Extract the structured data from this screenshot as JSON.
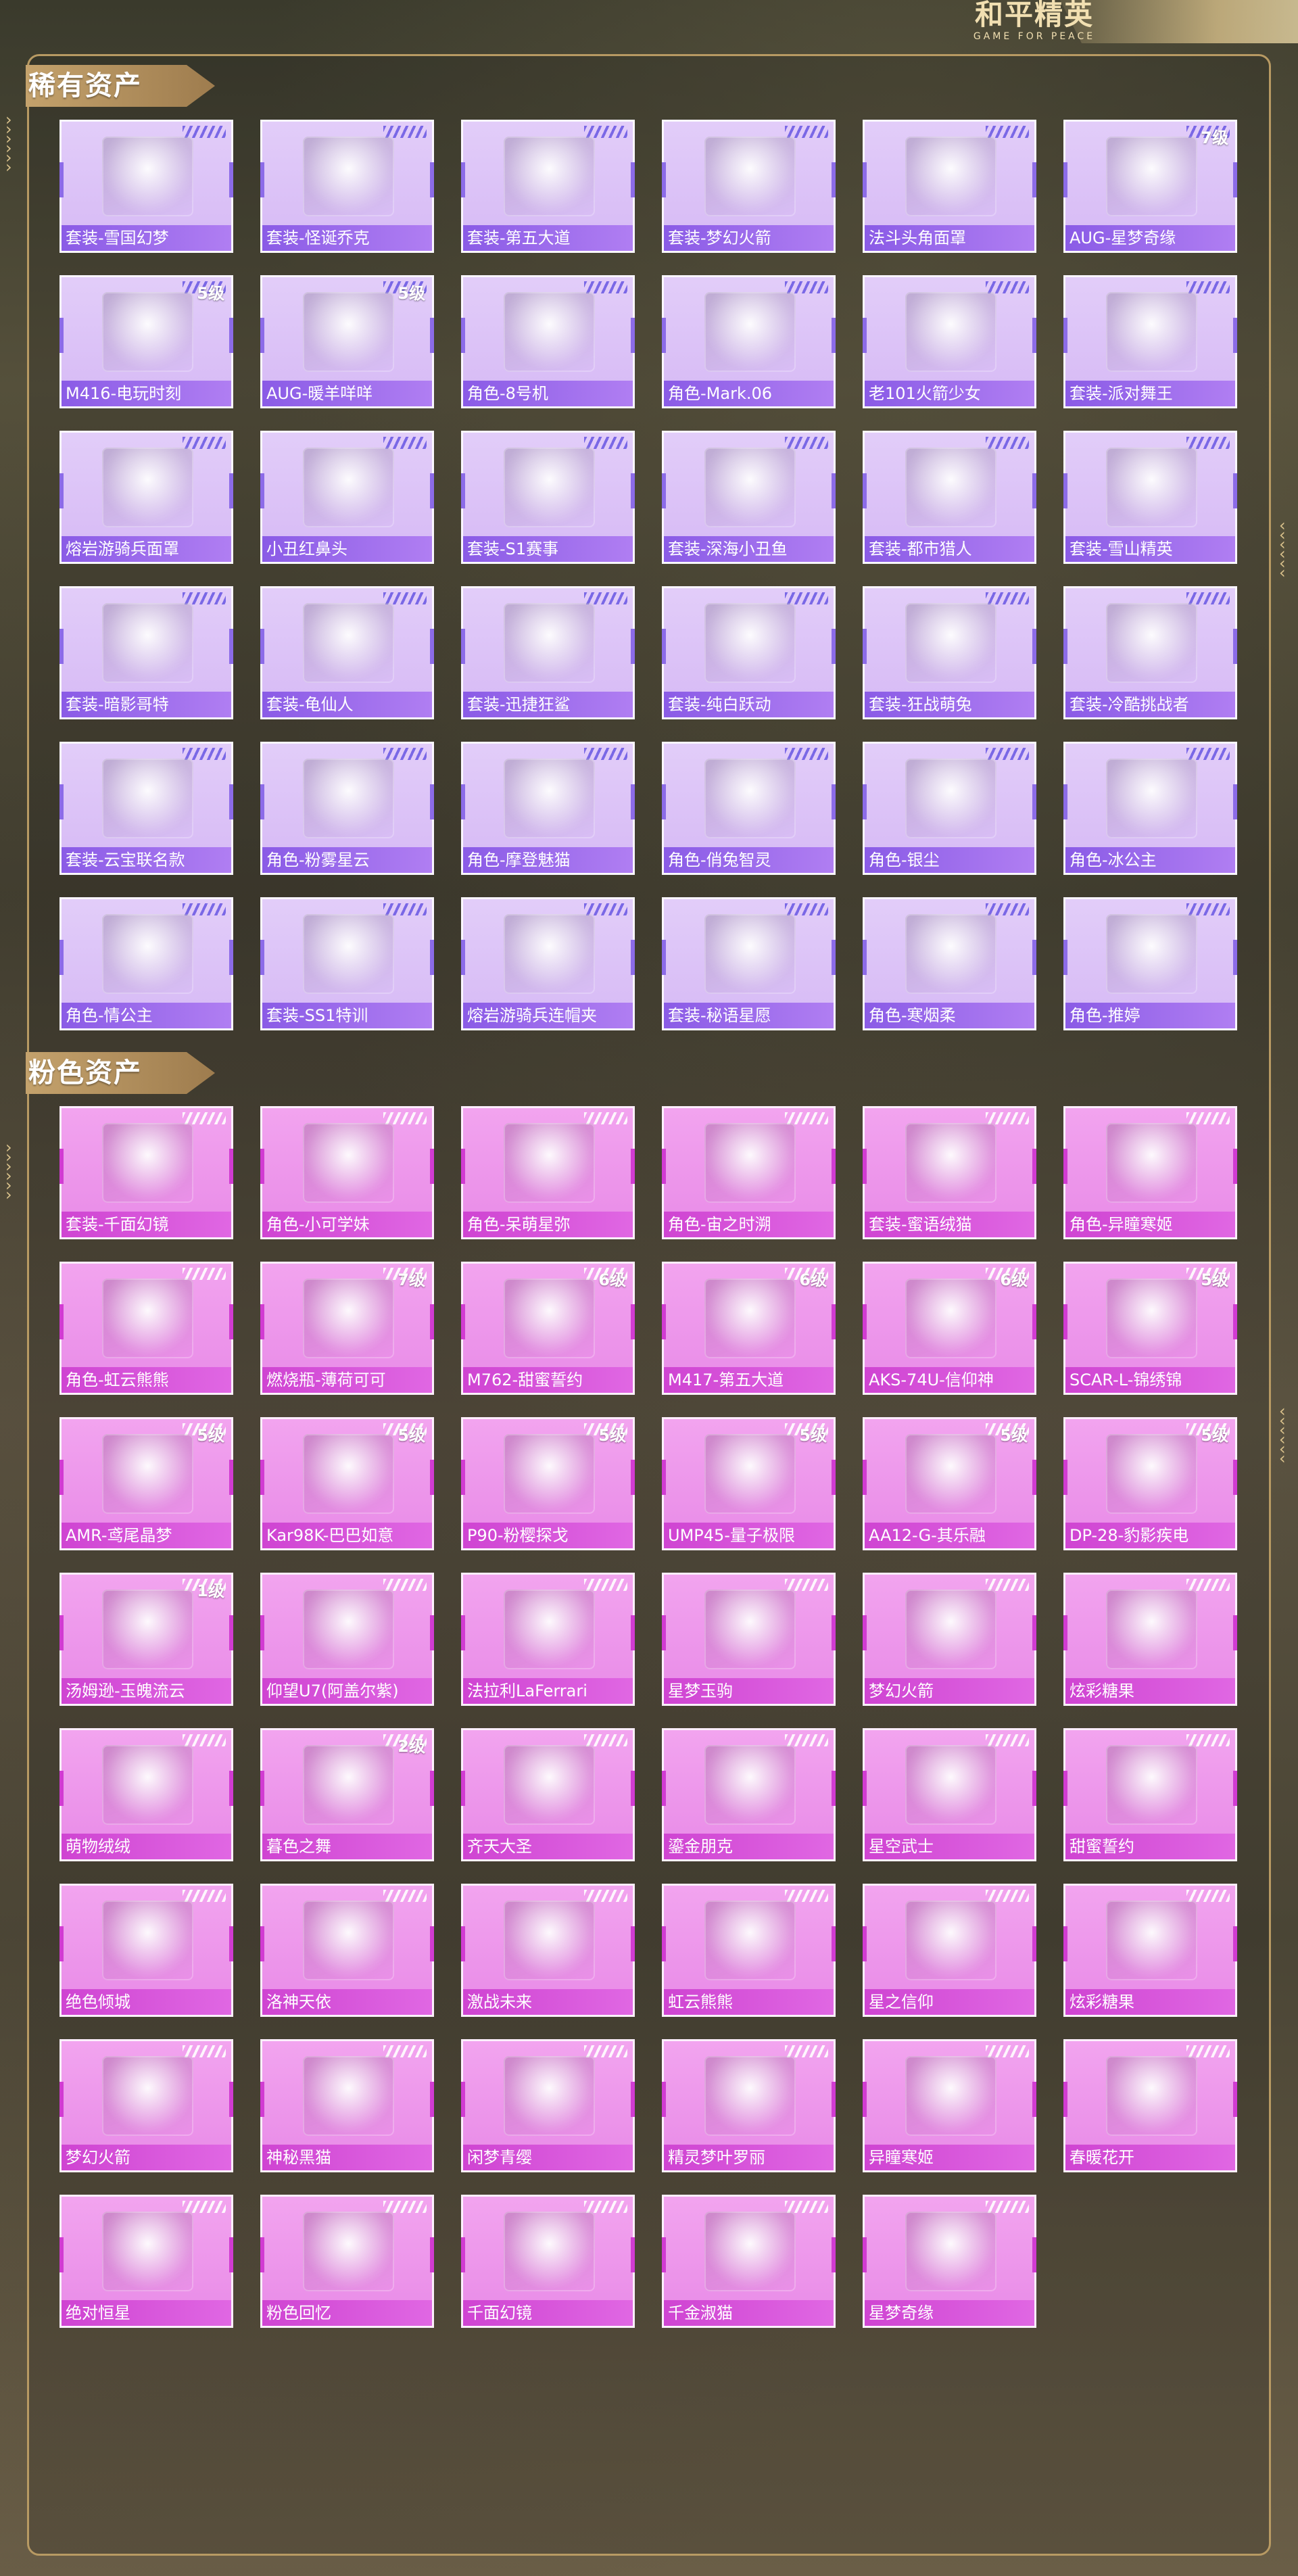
{
  "logo": {
    "title": "和平精英",
    "subtitle": "GAME FOR PEACE"
  },
  "sections": [
    {
      "id": "rare",
      "title": "稀有资产",
      "items": [
        {
          "label": "套装-雪国幻梦",
          "level": ""
        },
        {
          "label": "套装-怪诞乔克",
          "level": ""
        },
        {
          "label": "套装-第五大道",
          "level": ""
        },
        {
          "label": "套装-梦幻火箭",
          "level": ""
        },
        {
          "label": "法斗头角面罩",
          "level": ""
        },
        {
          "label": "AUG-星梦奇缘",
          "level": "7级"
        },
        {
          "label": "M416-电玩时刻",
          "level": "5级"
        },
        {
          "label": "AUG-暖羊咩咩",
          "level": "5级"
        },
        {
          "label": "角色-8号机",
          "level": ""
        },
        {
          "label": "角色-Mark.06",
          "level": ""
        },
        {
          "label": "老101火箭少女",
          "level": ""
        },
        {
          "label": "套装-派对舞王",
          "level": ""
        },
        {
          "label": "熔岩游骑兵面罩",
          "level": ""
        },
        {
          "label": "小丑红鼻头",
          "level": ""
        },
        {
          "label": "套装-S1赛事",
          "level": ""
        },
        {
          "label": "套装-深海小丑鱼",
          "level": ""
        },
        {
          "label": "套装-都市猎人",
          "level": ""
        },
        {
          "label": "套装-雪山精英",
          "level": ""
        },
        {
          "label": "套装-暗影哥特",
          "level": ""
        },
        {
          "label": "套装-龟仙人",
          "level": ""
        },
        {
          "label": "套装-迅捷狂鲨",
          "level": ""
        },
        {
          "label": "套装-纯白跃动",
          "level": ""
        },
        {
          "label": "套装-狂战萌兔",
          "level": ""
        },
        {
          "label": "套装-冷酷挑战者",
          "level": ""
        },
        {
          "label": "套装-云宝联名款",
          "level": ""
        },
        {
          "label": "角色-粉雾星云",
          "level": ""
        },
        {
          "label": "角色-摩登魅猫",
          "level": ""
        },
        {
          "label": "角色-俏兔智灵",
          "level": ""
        },
        {
          "label": "角色-银尘",
          "level": ""
        },
        {
          "label": "角色-冰公主",
          "level": ""
        },
        {
          "label": "角色-情公主",
          "level": ""
        },
        {
          "label": "套装-SS1特训",
          "level": ""
        },
        {
          "label": "熔岩游骑兵连帽夹",
          "level": ""
        },
        {
          "label": "套装-秘语星愿",
          "level": ""
        },
        {
          "label": "角色-寒烟柔",
          "level": ""
        },
        {
          "label": "角色-推婷",
          "level": ""
        }
      ]
    },
    {
      "id": "pink",
      "title": "粉色资产",
      "items": [
        {
          "label": "套装-千面幻镜",
          "level": ""
        },
        {
          "label": "角色-小可学妹",
          "level": ""
        },
        {
          "label": "角色-呆萌星弥",
          "level": ""
        },
        {
          "label": "角色-宙之时溯",
          "level": ""
        },
        {
          "label": "套装-蜜语绒猫",
          "level": ""
        },
        {
          "label": "角色-异瞳寒姬",
          "level": ""
        },
        {
          "label": "角色-虹云熊熊",
          "level": ""
        },
        {
          "label": "燃烧瓶-薄荷可可",
          "level": "7级"
        },
        {
          "label": "M762-甜蜜誓约",
          "level": "6级"
        },
        {
          "label": "M417-第五大道",
          "level": "6级"
        },
        {
          "label": "AKS-74U-信仰神",
          "level": "6级"
        },
        {
          "label": "SCAR-L-锦绣锦",
          "level": "5级"
        },
        {
          "label": "AMR-鸢尾晶梦",
          "level": "5级"
        },
        {
          "label": "Kar98K-巴巴如意",
          "level": "5级"
        },
        {
          "label": "P90-粉樱探戈",
          "level": "5级"
        },
        {
          "label": "UMP45-量子极限",
          "level": "5级"
        },
        {
          "label": "AA12-G-其乐融",
          "level": "5级"
        },
        {
          "label": "DP-28-豹影疾电",
          "level": "5级"
        },
        {
          "label": "汤姆逊-玉魄流云",
          "level": "1级"
        },
        {
          "label": "仰望U7(阿盖尔紫)",
          "level": ""
        },
        {
          "label": "法拉利LaFerrari",
          "level": ""
        },
        {
          "label": "星梦玉驹",
          "level": ""
        },
        {
          "label": "梦幻火箭",
          "level": ""
        },
        {
          "label": "炫彩糖果",
          "level": ""
        },
        {
          "label": "萌物绒绒",
          "level": ""
        },
        {
          "label": "暮色之舞",
          "level": "2级"
        },
        {
          "label": "齐天大圣",
          "level": ""
        },
        {
          "label": "鎏金朋克",
          "level": ""
        },
        {
          "label": "星空武士",
          "level": ""
        },
        {
          "label": "甜蜜誓约",
          "level": ""
        },
        {
          "label": "绝色倾城",
          "level": ""
        },
        {
          "label": "洛神天依",
          "level": ""
        },
        {
          "label": "激战未来",
          "level": ""
        },
        {
          "label": "虹云熊熊",
          "level": ""
        },
        {
          "label": "星之信仰",
          "level": ""
        },
        {
          "label": "炫彩糖果",
          "level": ""
        },
        {
          "label": "梦幻火箭",
          "level": ""
        },
        {
          "label": "神秘黑猫",
          "level": ""
        },
        {
          "label": "闲梦青缨",
          "level": ""
        },
        {
          "label": "精灵梦叶罗丽",
          "level": ""
        },
        {
          "label": "异瞳寒姬",
          "level": ""
        },
        {
          "label": "春暖花开",
          "level": ""
        },
        {
          "label": "绝对恒星",
          "level": ""
        },
        {
          "label": "粉色回忆",
          "level": ""
        },
        {
          "label": "千面幻镜",
          "level": ""
        },
        {
          "label": "千金淑猫",
          "level": ""
        },
        {
          "label": "星梦奇缘",
          "level": ""
        }
      ]
    }
  ]
}
